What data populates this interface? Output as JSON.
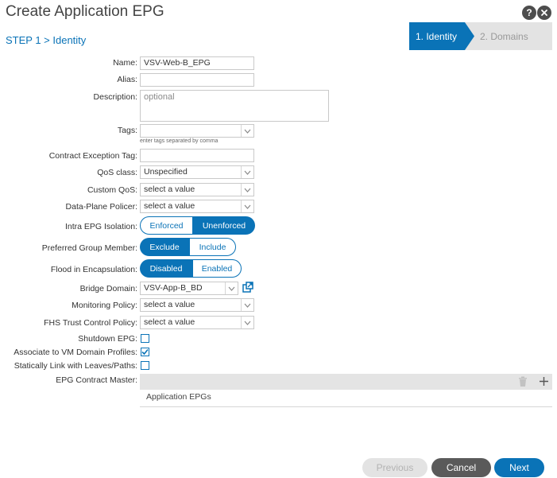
{
  "header": {
    "title": "Create Application EPG",
    "help_icon": "question-icon",
    "close_icon": "close-icon"
  },
  "step_label": "STEP 1 > Identity",
  "wizard": {
    "steps": [
      "1. Identity",
      "2. Domains"
    ],
    "active_step": "1. Identity"
  },
  "form": {
    "name": {
      "label": "Name:",
      "value": "VSV-Web-B_EPG"
    },
    "alias": {
      "label": "Alias:",
      "value": ""
    },
    "description": {
      "label": "Description:",
      "placeholder": "optional"
    },
    "tags": {
      "label": "Tags:",
      "value": "",
      "help": "enter tags separated by comma"
    },
    "contract_exception_tag": {
      "label": "Contract Exception Tag:",
      "value": ""
    },
    "qos_class": {
      "label": "QoS class:",
      "value": "Unspecified"
    },
    "custom_qos": {
      "label": "Custom QoS:",
      "value": "select a value"
    },
    "data_plane_policer": {
      "label": "Data-Plane Policer:",
      "value": "select a value"
    },
    "intra_epg_isolation": {
      "label": "Intra EPG Isolation:",
      "options": [
        "Enforced",
        "Unenforced"
      ],
      "selected": "Unenforced"
    },
    "preferred_group_member": {
      "label": "Preferred Group Member:",
      "options": [
        "Exclude",
        "Include"
      ],
      "selected": "Exclude"
    },
    "flood_in_encapsulation": {
      "label": "Flood in Encapsulation:",
      "options": [
        "Disabled",
        "Enabled"
      ],
      "selected": "Disabled"
    },
    "bridge_domain": {
      "label": "Bridge Domain:",
      "value": "VSV-App-B_BD"
    },
    "monitoring_policy": {
      "label": "Monitoring Policy:",
      "value": "select a value"
    },
    "fhs_trust_control_policy": {
      "label": "FHS Trust Control Policy:",
      "value": "select a value"
    },
    "shutdown_epg": {
      "label": "Shutdown EPG:",
      "checked": false
    },
    "associate_vm_domain_profiles": {
      "label": "Associate to VM Domain Profiles:",
      "checked": true
    },
    "statically_link": {
      "label": "Statically Link with Leaves/Paths:",
      "checked": false
    },
    "epg_contract_master": {
      "label": "EPG Contract Master:",
      "column_header": "Application EPGs"
    }
  },
  "footer": {
    "previous": "Previous",
    "cancel": "Cancel",
    "next": "Next"
  },
  "colors": {
    "accent": "#0a73b7",
    "cancel": "#5a5a5a",
    "disabled": "#e3e3e3"
  }
}
